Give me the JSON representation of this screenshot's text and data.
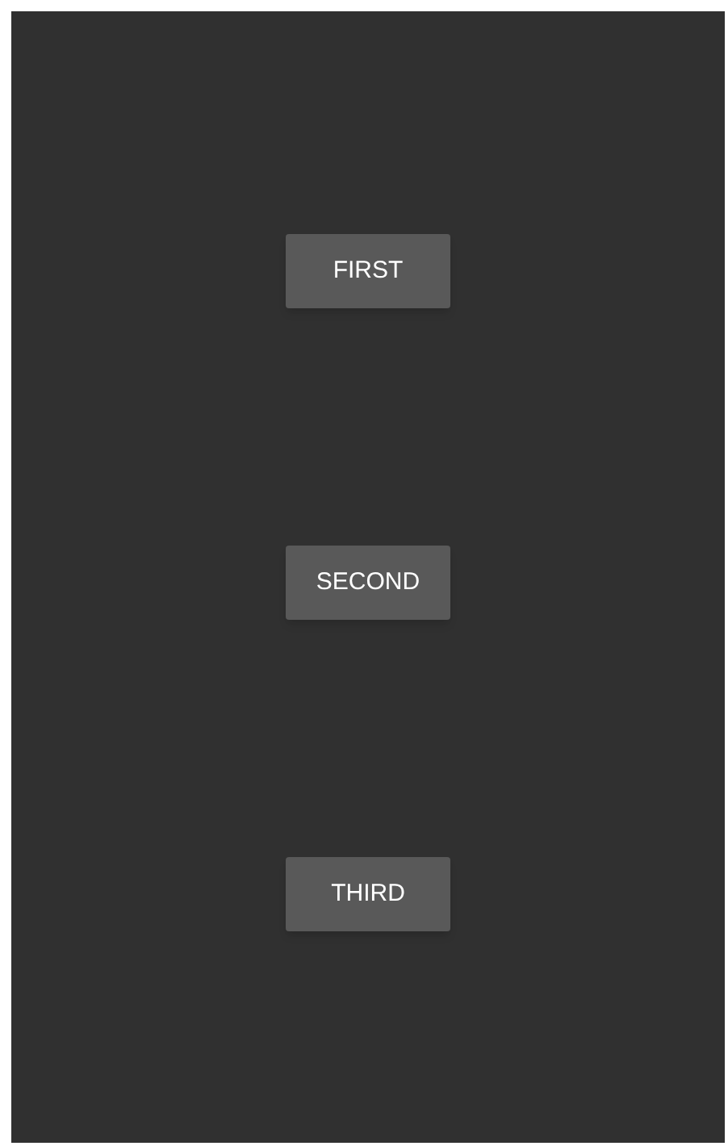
{
  "buttons": [
    {
      "label": "FIRST"
    },
    {
      "label": "SECOND"
    },
    {
      "label": "THIRD"
    }
  ]
}
